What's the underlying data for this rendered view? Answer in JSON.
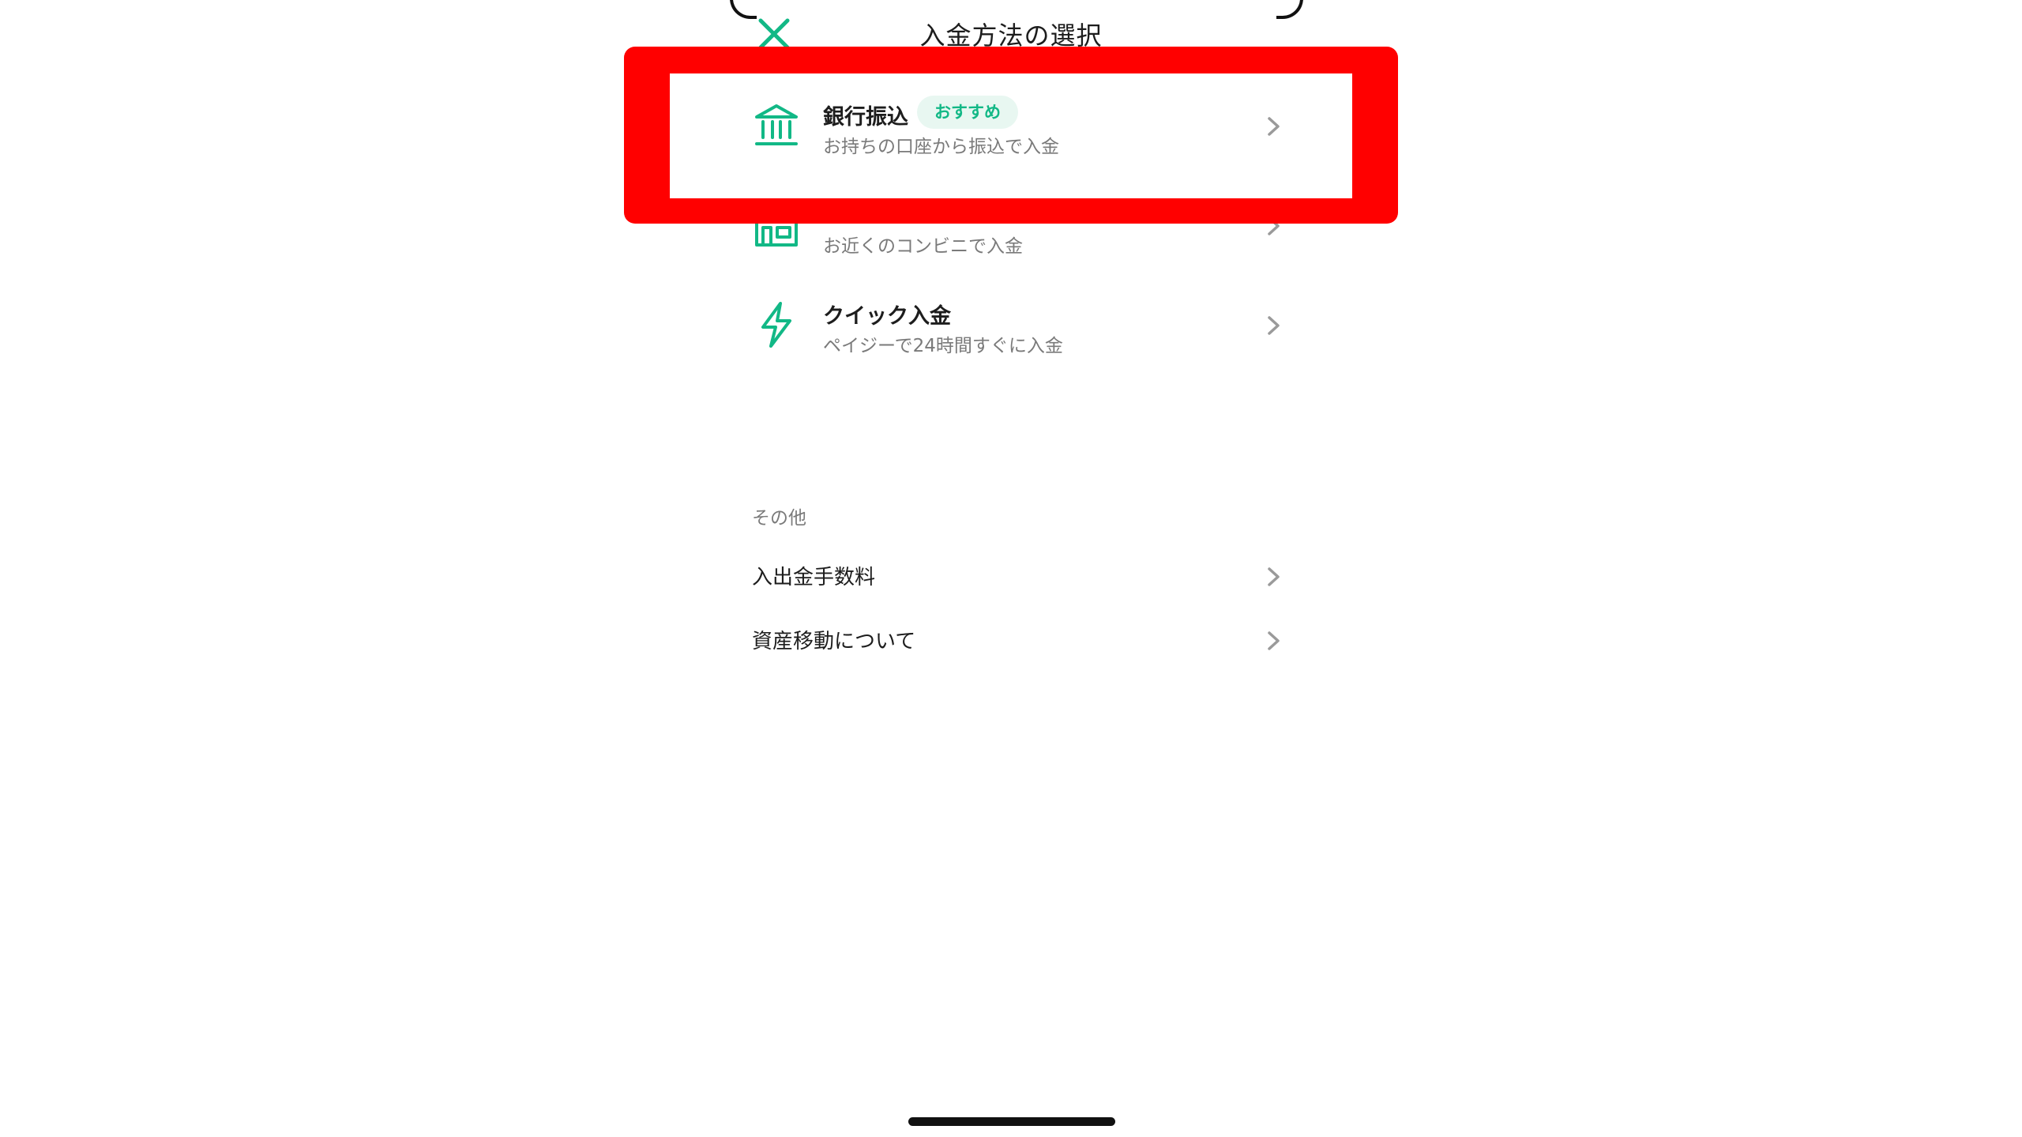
{
  "header": {
    "title": "入金方法の選択",
    "close_icon": "close-icon"
  },
  "payment_methods": [
    {
      "title": "銀行振込",
      "badge": "おすすめ",
      "subtitle": "お持ちの口座から振込で入金",
      "icon": "bank-icon"
    },
    {
      "title": "",
      "subtitle": "お近くのコンビニで入金",
      "icon": "convenience-store-icon"
    },
    {
      "title": "クイック入金",
      "subtitle": "ペイジーで24時間すぐに入金",
      "icon": "lightning-icon"
    }
  ],
  "other_section": {
    "label": "その他",
    "items": [
      {
        "label": "入出金手数料"
      },
      {
        "label": "資産移動について"
      }
    ]
  },
  "colors": {
    "accent": "#12b886",
    "badge_bg": "#e8f7f1",
    "highlight": "#ff0000",
    "chevron": "#9a9a9a"
  }
}
